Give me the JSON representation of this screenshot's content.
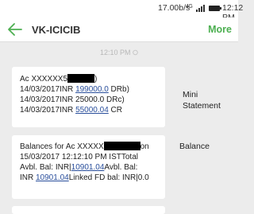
{
  "status_bar": {
    "speed": "17.00b/s",
    "signal_label": "4G",
    "time": "12:12 PM"
  },
  "header": {
    "title": "VK-ICICIB",
    "more_label": "More",
    "accent_color": "#4caf50"
  },
  "conversation": {
    "timestamp": "12:10 PM",
    "messages": [
      {
        "lines": {
          "l1": {
            "prefix": "Ac XXXXXX5",
            "suffix": ")"
          },
          "l2": {
            "prefix": "14/03/2017INR ",
            "link": "199000.0",
            "suffix": " DRb)"
          },
          "l3": {
            "text": "14/03/2017INR 25000.0 DRc)"
          },
          "l4": {
            "prefix": "14/03/2017INR ",
            "link": "55000.04",
            "suffix": " CR"
          }
        }
      },
      {
        "lines": {
          "l1": {
            "prefix": "Balances for Ac XXXXX",
            "suffix": "on"
          },
          "l2": {
            "text": "15/03/2017 12:12:10 PM ISTTotal"
          },
          "l3": {
            "prefix": "Avbl. Bal: INR|",
            "link": "10901.04",
            "suffix": "Avbl. Bal:"
          },
          "l4": {
            "prefix": "INR ",
            "link": "10901.04",
            "suffix": "Linked FD bal: INR|0.0"
          }
        }
      }
    ]
  },
  "annotations": {
    "mini_statement_line1": "Mini",
    "mini_statement_line2": "Statement",
    "balance": "Balance"
  }
}
